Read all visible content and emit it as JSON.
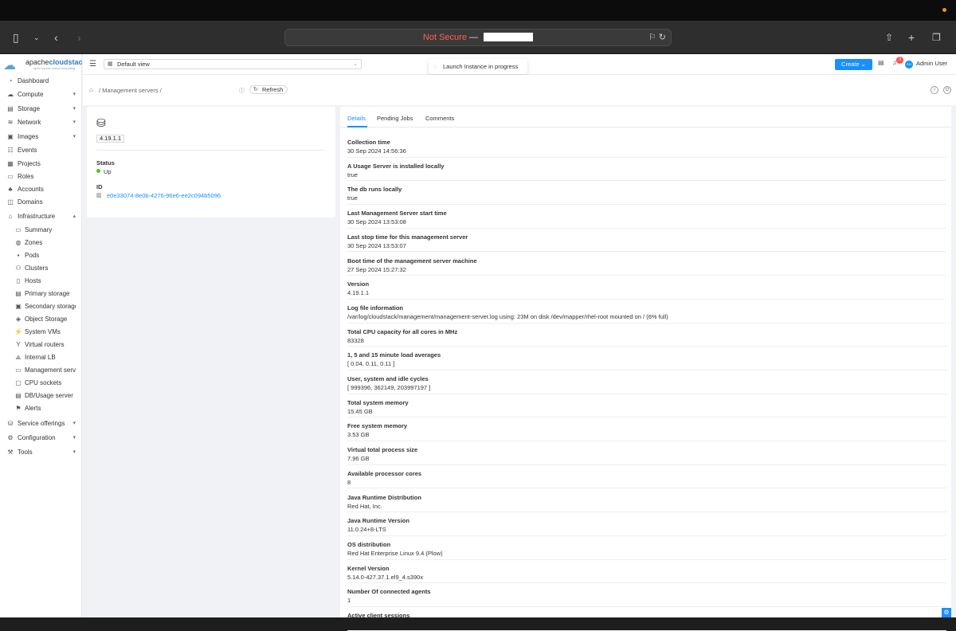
{
  "browser": {
    "address_status": "Not Secure",
    "address_sep": "—"
  },
  "app": {
    "logo_brand_a": "apache",
    "logo_brand_b": "cloudstack",
    "logo_tagline": "open source cloud computing"
  },
  "sidebar": {
    "items": [
      {
        "label": "Dashboard"
      },
      {
        "label": "Compute"
      },
      {
        "label": "Storage"
      },
      {
        "label": "Network"
      },
      {
        "label": "Images"
      },
      {
        "label": "Events"
      },
      {
        "label": "Projects"
      },
      {
        "label": "Roles"
      },
      {
        "label": "Accounts"
      },
      {
        "label": "Domains"
      },
      {
        "label": "Infrastructure"
      }
    ],
    "sub": [
      {
        "label": "Summary"
      },
      {
        "label": "Zones"
      },
      {
        "label": "Pods"
      },
      {
        "label": "Clusters"
      },
      {
        "label": "Hosts"
      },
      {
        "label": "Primary storage"
      },
      {
        "label": "Secondary storage"
      },
      {
        "label": "Object Storage"
      },
      {
        "label": "System VMs"
      },
      {
        "label": "Virtual routers"
      },
      {
        "label": "Internal LB"
      },
      {
        "label": "Management servers"
      },
      {
        "label": "CPU sockets"
      },
      {
        "label": "DB/Usage server"
      },
      {
        "label": "Alerts"
      }
    ],
    "bottom": [
      {
        "label": "Service offerings"
      },
      {
        "label": "Configuration"
      },
      {
        "label": "Tools"
      }
    ]
  },
  "header": {
    "view": "Default view",
    "toast": "Launch Instance in progress",
    "create": "Create",
    "notif_count": "3",
    "avatar": "AU",
    "user": "Admin User"
  },
  "breadcrumb": {
    "sep": "/",
    "section": "Management servers",
    "refresh": "Refresh"
  },
  "summary": {
    "version": "4.19.1.1",
    "status_label": "Status",
    "status_value": "Up",
    "id_label": "ID",
    "id_value": "e0e33074-8e0b-4276-96e6-ee2c094b5096"
  },
  "tabs": [
    "Details",
    "Pending Jobs",
    "Comments"
  ],
  "details": [
    {
      "k": "Collection time",
      "v": "30 Sep 2024 14:56:36"
    },
    {
      "k": "A Usage Server is installed locally",
      "v": "true"
    },
    {
      "k": "The db runs locally",
      "v": "true"
    },
    {
      "k": "Last Management Server start time",
      "v": "30 Sep 2024 13:53:08"
    },
    {
      "k": "Last stop time for this management server",
      "v": "30 Sep 2024 13:53:07"
    },
    {
      "k": "Boot time of the management server machine",
      "v": "27 Sep 2024 15:27:32"
    },
    {
      "k": "Version",
      "v": "4.19.1.1"
    },
    {
      "k": "Log file information",
      "v": "/var/log/cloudstack/management/management-server.log using: 23M on disk /dev/mapper/rhel-root mounted on / (6% full)"
    },
    {
      "k": "Total CPU capacity for all cores in MHz",
      "v": "83328"
    },
    {
      "k": "1, 5 and 15 minute load averages",
      "v": "[ 0.04, 0.11, 0.11 ]"
    },
    {
      "k": "User, system and idle cycles",
      "v": "[ 999396, 362149, 203997197 ]"
    },
    {
      "k": "Total system memory",
      "v": "15.45 GB"
    },
    {
      "k": "Free system memory",
      "v": "3.53 GB"
    },
    {
      "k": "Virtual total process size",
      "v": "7.96 GB"
    },
    {
      "k": "Available processor cores",
      "v": "8"
    },
    {
      "k": "Java Runtime Distribution",
      "v": "Red Hat, Inc."
    },
    {
      "k": "Java Runtime Version",
      "v": "11.0.24+8-LTS"
    },
    {
      "k": "OS distribution",
      "v": "Red Hat Enterprise Linux 9.4 (Plow)"
    },
    {
      "k": "Kernel Version",
      "v": "5.14.0-427.37.1.el9_4.s390x"
    },
    {
      "k": "Number Of connected agents",
      "v": "1"
    },
    {
      "k": "Active client sessions",
      "v": ""
    }
  ]
}
